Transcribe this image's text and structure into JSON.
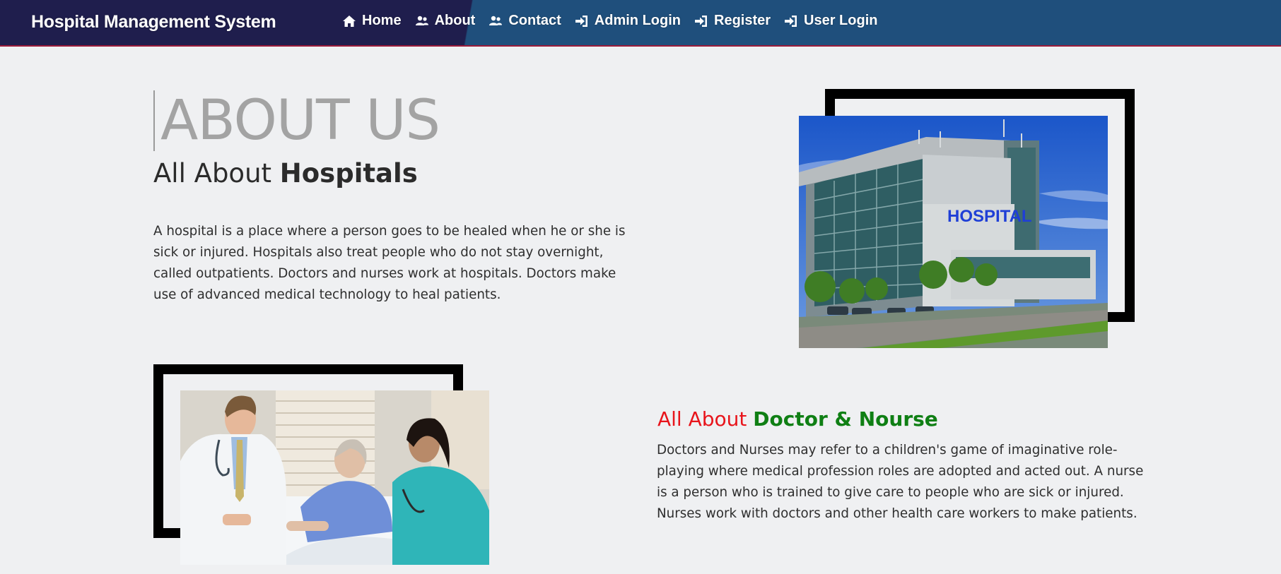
{
  "navbar": {
    "brand": "Hospital Management System",
    "items": [
      {
        "label": "Home",
        "icon": "home-icon"
      },
      {
        "label": "About",
        "icon": "users-icon"
      },
      {
        "label": "Contact",
        "icon": "users-icon"
      },
      {
        "label": "Admin Login",
        "icon": "sign-in-icon"
      },
      {
        "label": "Register",
        "icon": "sign-in-icon"
      },
      {
        "label": "User Login",
        "icon": "sign-in-icon"
      }
    ]
  },
  "about": {
    "title": "ABOUT US",
    "subtitle_normal": "All About ",
    "subtitle_bold": "Hospitals",
    "paragraph": "A hospital is a place where a person goes to be healed when he or she is sick or injured. Hospitals also treat people who do not stay overnight, called outpatients. Doctors and nurses work at hospitals. Doctors make use of advanced medical technology to heal patients.",
    "hospital_image_sign": "HOSPITAL"
  },
  "doctor": {
    "heading_red": "All About ",
    "heading_green": "Doctor & Nourse",
    "paragraph": "Doctors and Nurses may refer to a children's game of imaginative role-playing where medical profession roles are adopted and acted out. A nurse is a person who is trained to give care to people who are sick or injured. Nurses work with doctors and other health care workers to make patients."
  },
  "colors": {
    "nav_dark": "#1f1e4d",
    "nav_blue": "#1f4f7c",
    "heading_red": "#e8141b",
    "heading_green": "#0f7f14",
    "page_bg": "#eff0f2"
  }
}
